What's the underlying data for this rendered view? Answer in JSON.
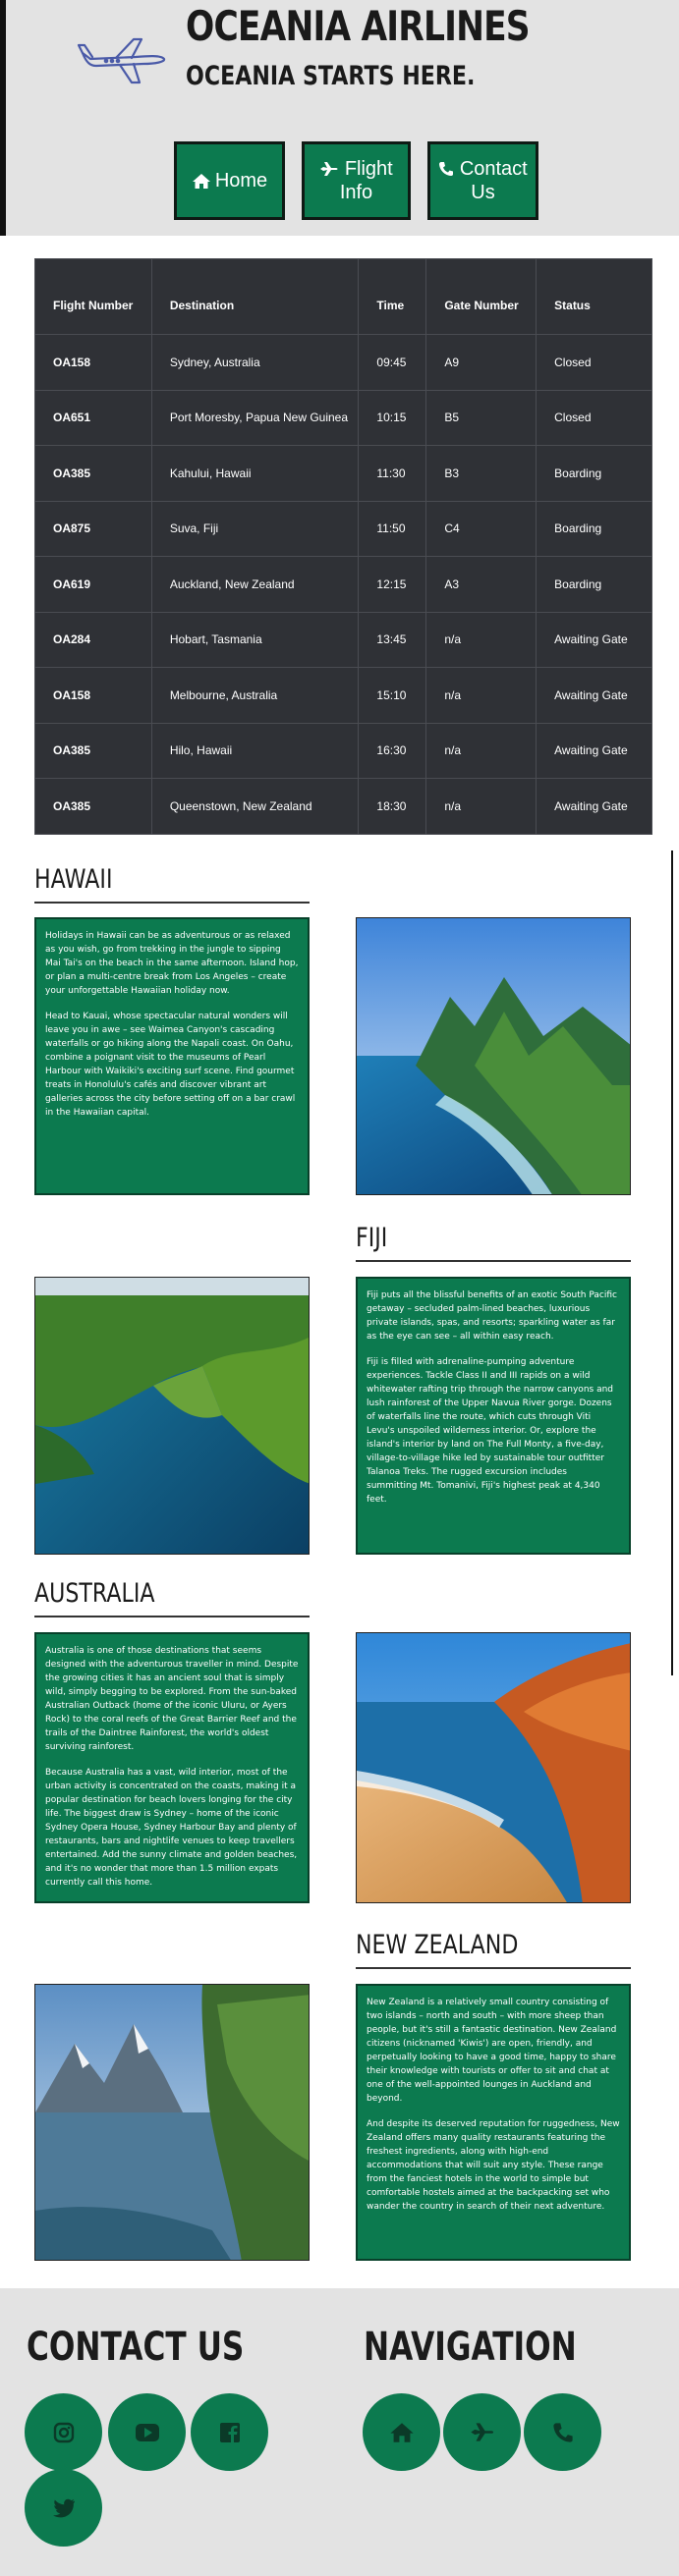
{
  "header": {
    "title": "OCEANIA AIRLINES",
    "subtitle": "OCEANIA STARTS HERE.",
    "logo_icon": "airplane-logo-icon",
    "nav": [
      {
        "label": "Home",
        "icon": "home-icon"
      },
      {
        "label": "Flight Info",
        "icon": "plane-icon"
      },
      {
        "label": "Contact Us",
        "icon": "phone-icon"
      }
    ]
  },
  "flights": {
    "headers": [
      "Flight Number",
      "Destination",
      "Time",
      "Gate Number",
      "Status"
    ],
    "rows": [
      [
        "OA158",
        "Sydney, Australia",
        "09:45",
        "A9",
        "Closed"
      ],
      [
        "OA651",
        "Port Moresby, Papua New Guinea",
        "10:15",
        "B5",
        "Closed"
      ],
      [
        "OA385",
        "Kahului, Hawaii",
        "11:30",
        "B3",
        "Boarding"
      ],
      [
        "OA875",
        "Suva, Fiji",
        "11:50",
        "C4",
        "Boarding"
      ],
      [
        "OA619",
        "Auckland, New Zealand",
        "12:15",
        "A3",
        "Boarding"
      ],
      [
        "OA284",
        "Hobart, Tasmania",
        "13:45",
        "n/a",
        "Awaiting Gate"
      ],
      [
        "OA158",
        "Melbourne, Australia",
        "15:10",
        "n/a",
        "Awaiting Gate"
      ],
      [
        "OA385",
        "Hilo, Hawaii",
        "16:30",
        "n/a",
        "Awaiting Gate"
      ],
      [
        "OA385",
        "Queenstown, New Zealand",
        "18:30",
        "n/a",
        "Awaiting Gate"
      ]
    ]
  },
  "destinations": {
    "hawaii": {
      "title": "HAWAII",
      "p1": "Holidays in Hawaii can be as adventurous or as relaxed as you wish, go from trekking in the jungle to sipping Mai Tai's on the beach in the same afternoon. Island hop, or plan a multi-centre break from Los Angeles – create your unforgettable Hawaiian holiday now.",
      "p2": "Head to Kauai, whose spectacular natural wonders will leave you in awe – see Waimea Canyon's cascading waterfalls or go hiking along the Napali coast. On Oahu, combine a poignant visit to the museums of Pearl Harbour with Waikiki's exciting surf scene. Find gourmet treats in Honolulu's cafés and discover vibrant art galleries across the city before setting off on a bar crawl in the Hawaiian capital."
    },
    "fiji": {
      "title": "FIJI",
      "p1": "Fiji puts all the blissful benefits of an exotic South Pacific getaway – secluded palm-lined beaches, luxurious private islands, spas, and resorts; sparkling water as far as the eye can see – all within easy reach.",
      "p2": "Fiji is filled with adrenaline-pumping adventure experiences. Tackle Class II and III rapids on a wild whitewater rafting trip through the narrow canyons and lush rainforest of the Upper Navua River gorge. Dozens of waterfalls line the route, which cuts through Viti Levu's unspoiled wilderness interior. Or, explore the island's interior by land on The Full Monty, a five-day, village-to-village hike led by sustainable tour outfitter Talanoa Treks. The rugged excursion includes summitting Mt. Tomanivi, Fiji's highest peak at 4,340 feet."
    },
    "australia": {
      "title": "AUSTRALIA",
      "p1": "Australia is one of those destinations that seems designed with the adventurous traveller in mind. Despite the growing cities it has an ancient soul that is simply wild, simply begging to be explored. From the sun-baked Australian Outback (home of the iconic Uluru, or Ayers Rock) to the coral reefs of the Great Barrier Reef and the trails of the Daintree Rainforest, the world's oldest surviving rainforest.",
      "p2": "Because Australia has a vast, wild interior, most of the urban activity is concentrated on the coasts, making it a popular destination for beach lovers longing for the city life. The biggest draw is Sydney – home of the iconic Sydney Opera House, Sydney Harbour Bay and plenty of restaurants, bars and nightlife venues to keep travellers entertained. Add the sunny climate and golden beaches, and it's no wonder that more than 1.5 million expats currently call this home."
    },
    "newzealand": {
      "title": "NEW ZEALAND",
      "p1": "New Zealand is a relatively small country consisting of two islands – north and south – with more sheep than people, but it's still a fantastic destination. New Zealand citizens (nicknamed 'Kiwis') are open, friendly, and perpetually looking to have a good time, happy to share their knowledge with tourists or offer to sit and chat at one of the well-appointed lounges in Auckland and beyond.",
      "p2": "And despite its deserved reputation for ruggedness, New Zealand offers many quality restaurants featuring the freshest ingredients, along with high-end accommodations that will suit any style. These range from the fanciest hotels in the world to simple but comfortable hostels aimed at the backpacking set who wander the country in search of their next adventure."
    }
  },
  "footer": {
    "contact_title": "CONTACT US",
    "nav_title": "NAVIGATION",
    "social_icons": [
      "instagram-icon",
      "youtube-icon",
      "facebook-icon",
      "twitter-icon"
    ],
    "nav_icons": [
      "home-icon",
      "plane-icon",
      "phone-icon"
    ]
  },
  "colors": {
    "accent": "#0c7a4f",
    "header_bg": "#e3e3e3",
    "table_bg": "#2f3136",
    "icon_dark": "#0b3a28"
  }
}
